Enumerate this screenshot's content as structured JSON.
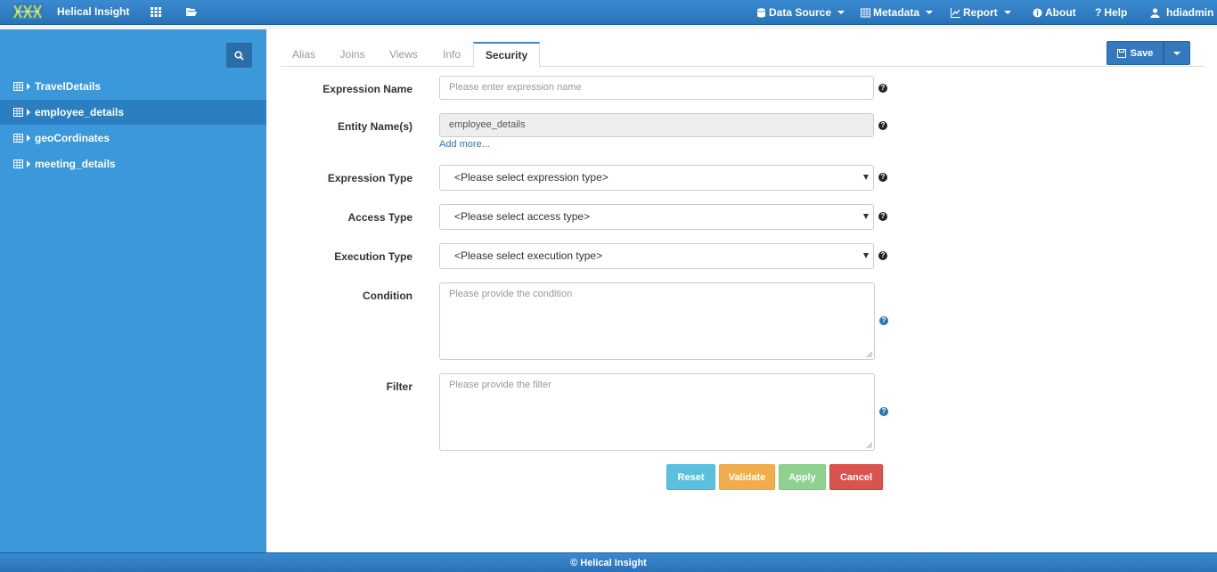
{
  "navbar": {
    "brand": "Helical Insight",
    "menu": [
      {
        "label": "Data Source",
        "icon": "database-icon"
      },
      {
        "label": "Metadata",
        "icon": "table-icon"
      },
      {
        "label": "Report",
        "icon": "chart-icon"
      },
      {
        "label": "About",
        "icon": "info-icon"
      },
      {
        "label": "Help",
        "icon": "question-icon"
      },
      {
        "label": "hdiadmin",
        "icon": "user-icon"
      }
    ]
  },
  "sidebar": {
    "items": [
      {
        "label": "TravelDetails",
        "active": false
      },
      {
        "label": "employee_details",
        "active": true
      },
      {
        "label": "geoCordinates",
        "active": false
      },
      {
        "label": "meeting_details",
        "active": false
      }
    ]
  },
  "tabs": [
    "Alias",
    "Joins",
    "Views",
    "Info",
    "Security"
  ],
  "active_tab": "Security",
  "toolbar": {
    "save_label": "Save"
  },
  "form": {
    "expression_name": {
      "label": "Expression Name",
      "placeholder": "Please enter expression name",
      "value": ""
    },
    "entity_names": {
      "label": "Entity Name(s)",
      "value": "employee_details",
      "add_more": "Add more..."
    },
    "expression_type": {
      "label": "Expression Type",
      "selected": "<Please select expression type>"
    },
    "access_type": {
      "label": "Access Type",
      "selected": "<Please select access type>"
    },
    "execution_type": {
      "label": "Execution Type",
      "selected": "<Please select execution type>"
    },
    "condition": {
      "label": "Condition",
      "placeholder": "Please provide the condition",
      "value": ""
    },
    "filter": {
      "label": "Filter",
      "placeholder": "Please provide the filter",
      "value": ""
    }
  },
  "buttons": {
    "reset": "Reset",
    "validate": "Validate",
    "apply": "Apply",
    "cancel": "Cancel"
  },
  "footer": {
    "text": "Helical Insight",
    "symbol": "©"
  },
  "colors": {
    "navbar": "#2f7ec5",
    "sidebar": "#3a98db",
    "sidebar_active": "#2b7fc0",
    "save": "#3478bd"
  }
}
